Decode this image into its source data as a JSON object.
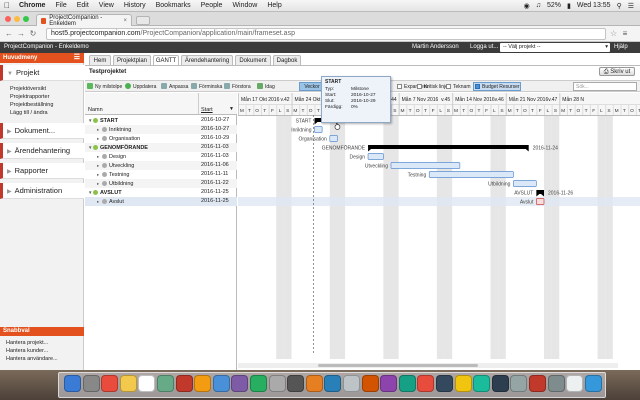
{
  "mac_menu": {
    "app": "Chrome",
    "items": [
      "File",
      "Edit",
      "View",
      "History",
      "Bookmarks",
      "People",
      "Window",
      "Help"
    ],
    "battery": "52%",
    "clock": "Wed 13:55"
  },
  "browser": {
    "tab_title": "ProjectCompanion - Enkeldem",
    "url_host": "host5.projectcompanion.com",
    "url_path": "/ProjectCompanion/application/main/frameset.asp"
  },
  "app_header": {
    "title": "ProjectCompanion - Enkeldemo",
    "user": "Martin Andersson",
    "logout": "Logga ut...",
    "project_select": "-- Välj projekt --",
    "help": "Hjälp"
  },
  "sidebar": {
    "header": "Huvudmeny",
    "sections": [
      {
        "label": "Projekt",
        "open": true
      },
      {
        "label": "Dokument..."
      },
      {
        "label": "Ärendehantering"
      },
      {
        "label": "Rapporter"
      },
      {
        "label": "Administration"
      }
    ],
    "projekt_items": [
      "Projektöversikt",
      "Projektrapporter",
      "Projektbeställning",
      "Lägg till / ändra"
    ],
    "quick_header": "Snabbval",
    "quick_items": [
      "Hantera projekt...",
      "Hantera kunder...",
      "Hantera användare..."
    ]
  },
  "tabs": [
    "Hem",
    "Projektplan",
    "GANTT",
    "Ärendehantering",
    "Dokument",
    "Dagbok"
  ],
  "active_tab": "GANTT",
  "project_name": "Testprojektet",
  "print_button": "Skriv ut",
  "toolbar": {
    "new_milestone": "Ny milstolpe",
    "update": "Uppdatera",
    "fit": "Anpassa",
    "zoom_out": "Förminska",
    "zoom_in": "Förstora",
    "today": "Idag",
    "week": "Veckor",
    "expand": "Expandera",
    "critical_line": "Kritisk linje",
    "team": "Teknam",
    "budget_resources": "Budget Resurser",
    "search_placeholder": "Sök..."
  },
  "grid": {
    "col_name": "Namn",
    "col_start": "Start"
  },
  "rows": [
    {
      "name": "START",
      "start": "2016-10-27",
      "level": 0,
      "type": "group"
    },
    {
      "name": "Inriktning",
      "start": "2016-10-27",
      "level": 1,
      "type": "task"
    },
    {
      "name": "Organisation",
      "start": "2016-10-29",
      "level": 1,
      "type": "task"
    },
    {
      "name": "GENOMFÖRANDE",
      "start": "2016-11-03",
      "level": 0,
      "type": "group"
    },
    {
      "name": "Design",
      "start": "2016-11-03",
      "level": 1,
      "type": "task"
    },
    {
      "name": "Utveckling",
      "start": "2016-11-06",
      "level": 1,
      "type": "task"
    },
    {
      "name": "Testning",
      "start": "2016-11-11",
      "level": 1,
      "type": "task"
    },
    {
      "name": "Utbildning",
      "start": "2016-11-22",
      "level": 1,
      "type": "task"
    },
    {
      "name": "AVSLUT",
      "start": "2016-11-25",
      "level": 0,
      "type": "group"
    },
    {
      "name": "Avslut",
      "start": "2016-11-25",
      "level": 1,
      "type": "task"
    }
  ],
  "timeline": {
    "weeks": [
      {
        "label": "Mån 17 Okt 2016",
        "week": "v.42"
      },
      {
        "label": "Mån 24 Okt 2016",
        "week": "v.43"
      },
      {
        "label": "Mån 31 Okt 2016",
        "week": "v.44"
      },
      {
        "label": "Mån 7 Nov 2016",
        "week": "v.45"
      },
      {
        "label": "Mån 14 Nov 2016",
        "week": "v.46"
      },
      {
        "label": "Mån 21 Nov 2016",
        "week": "v.47"
      },
      {
        "label": "Mån 28 N",
        "week": ""
      }
    ],
    "day_letters": [
      "M",
      "T",
      "O",
      "T",
      "F",
      "L",
      "S"
    ]
  },
  "bar_labels": [
    {
      "row": 0,
      "left": "START",
      "right": "2016-10-30"
    },
    {
      "row": 1,
      "left": "Inriktning",
      "right": ""
    },
    {
      "row": 2,
      "left": "Organisation",
      "right": ""
    },
    {
      "row": 3,
      "left": "GENOMFÖRANDE",
      "right": "2016-11-24"
    },
    {
      "row": 4,
      "left": "Design",
      "right": ""
    },
    {
      "row": 5,
      "left": "Utveckling",
      "right": ""
    },
    {
      "row": 6,
      "left": "Testning",
      "right": ""
    },
    {
      "row": 7,
      "left": "Utbildning",
      "right": ""
    },
    {
      "row": 8,
      "left": "AVSLUT",
      "right": "2016-11-26"
    },
    {
      "row": 9,
      "left": "Avslut",
      "right": ""
    }
  ],
  "tooltip": {
    "title": "START",
    "rows": [
      {
        "k": "Typ:",
        "v": "Milstone"
      },
      {
        "k": "Start:",
        "v": "2016-10-27"
      },
      {
        "k": "Slut:",
        "v": "2016-10-29"
      },
      {
        "k": "Färdigg:",
        "v": "0%"
      }
    ]
  },
  "colors": {
    "accent": "#e3521e",
    "sidebar_border": "#c0392b",
    "app_header": "#3b3b3b",
    "bar_fill": "#dbe8f8",
    "bar_stroke": "#5b8ed0",
    "group_bar": "#000000",
    "weekend": "#e6e6e6",
    "today_line": "#777777"
  }
}
